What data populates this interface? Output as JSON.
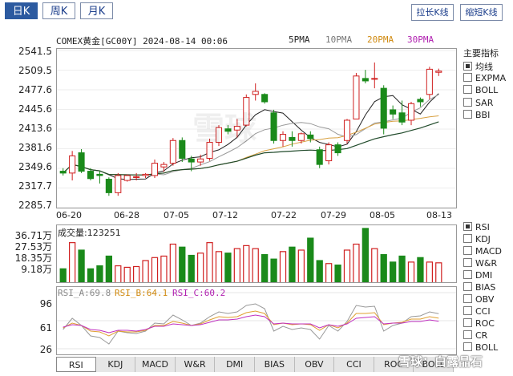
{
  "period_tabs": [
    "日K",
    "周K",
    "月K"
  ],
  "right_buttons": [
    "拉长K线",
    "缩短K线"
  ],
  "chart": {
    "title": "COMEX黄金[GC00Y] 2024-08-14 00:06",
    "ma_legend": [
      {
        "label": "5PMA",
        "color": "#222222"
      },
      {
        "label": "10PMA",
        "color": "#999999"
      },
      {
        "label": "20PMA",
        "color": "#e0a030"
      },
      {
        "label": "30PMA",
        "color": "#c030c0"
      }
    ],
    "y_ticks": [
      "2541.5",
      "2509.5",
      "2477.6",
      "2445.6",
      "2413.6",
      "2381.6",
      "2349.6",
      "2317.7",
      "2285.7"
    ],
    "x_ticks": [
      "06-20",
      "06-28",
      "07-05",
      "07-12",
      "07-22",
      "07-29",
      "08-05",
      "08-13"
    ],
    "watermark": "雪球"
  },
  "indicators": {
    "title": "主要指标",
    "main": [
      {
        "label": "均线",
        "checked": true
      },
      {
        "label": "EXPMA",
        "checked": false
      },
      {
        "label": "BOLL",
        "checked": false
      },
      {
        "label": "SAR",
        "checked": false
      },
      {
        "label": "BBI",
        "checked": false
      }
    ],
    "sub": [
      {
        "label": "RSI",
        "checked": true
      },
      {
        "label": "KDJ",
        "checked": false
      },
      {
        "label": "MACD",
        "checked": false
      },
      {
        "label": "W&R",
        "checked": false
      },
      {
        "label": "DMI",
        "checked": false
      },
      {
        "label": "BIAS",
        "checked": false
      },
      {
        "label": "OBV",
        "checked": false
      },
      {
        "label": "CCI",
        "checked": false
      },
      {
        "label": "ROC",
        "checked": false
      },
      {
        "label": "CR",
        "checked": false
      },
      {
        "label": "BOLL",
        "checked": false
      }
    ]
  },
  "volume": {
    "label": "成交量:123251",
    "y_ticks": [
      "36.71万",
      "27.53万",
      "18.35万",
      "9.18万"
    ]
  },
  "rsi": {
    "labels": [
      {
        "text": "RSI_A:69.8",
        "color": "#888888"
      },
      {
        "text": "RSI_B:64.1",
        "color": "#e0a030"
      },
      {
        "text": "RSI_C:60.2",
        "color": "#c030c0"
      }
    ],
    "y_ticks": [
      "96",
      "61",
      "26"
    ]
  },
  "bottom_tabs": [
    "RSI",
    "KDJ",
    "MACD",
    "W&R",
    "DMI",
    "BIAS",
    "OBV",
    "CCI",
    "ROC",
    "BOLL"
  ],
  "footer_brand": "雪球：白露晶石",
  "colors": {
    "up": "#d02020",
    "down": "#1a8a1a",
    "accent": "#2c5aa0"
  },
  "chart_data": {
    "type": "candlestick",
    "ylim": [
      2285.7,
      2541.5
    ],
    "x_ticks": [
      "06-20",
      "06-28",
      "07-05",
      "07-12",
      "07-22",
      "07-29",
      "08-05",
      "08-13"
    ],
    "ohlc": [
      [
        2345,
        2350,
        2338,
        2342
      ],
      [
        2342,
        2378,
        2330,
        2370
      ],
      [
        2375,
        2381,
        2342,
        2345
      ],
      [
        2345,
        2350,
        2330,
        2333
      ],
      [
        2340,
        2345,
        2325,
        2338
      ],
      [
        2332,
        2335,
        2305,
        2310
      ],
      [
        2310,
        2342,
        2305,
        2338
      ],
      [
        2330,
        2340,
        2328,
        2338
      ],
      [
        2335,
        2342,
        2330,
        2336
      ],
      [
        2338,
        2342,
        2334,
        2340
      ],
      [
        2338,
        2364,
        2334,
        2358
      ],
      [
        2352,
        2360,
        2344,
        2356
      ],
      [
        2358,
        2399,
        2354,
        2395
      ],
      [
        2395,
        2400,
        2360,
        2366
      ],
      [
        2365,
        2370,
        2345,
        2360
      ],
      [
        2360,
        2372,
        2354,
        2365
      ],
      [
        2366,
        2398,
        2362,
        2392
      ],
      [
        2392,
        2420,
        2386,
        2416
      ],
      [
        2414,
        2420,
        2405,
        2410
      ],
      [
        2412,
        2430,
        2400,
        2418
      ],
      [
        2420,
        2470,
        2418,
        2465
      ],
      [
        2470,
        2488,
        2460,
        2475
      ],
      [
        2470,
        2472,
        2455,
        2458
      ],
      [
        2440,
        2445,
        2390,
        2395
      ],
      [
        2395,
        2410,
        2385,
        2405
      ],
      [
        2400,
        2410,
        2385,
        2395
      ],
      [
        2395,
        2408,
        2390,
        2406
      ],
      [
        2404,
        2410,
        2392,
        2398
      ],
      [
        2380,
        2385,
        2350,
        2356
      ],
      [
        2362,
        2392,
        2356,
        2388
      ],
      [
        2388,
        2392,
        2370,
        2375
      ],
      [
        2395,
        2430,
        2390,
        2428
      ],
      [
        2430,
        2505,
        2430,
        2500
      ],
      [
        2496,
        2510,
        2488,
        2492
      ],
      [
        2495,
        2522,
        2480,
        2496
      ],
      [
        2480,
        2485,
        2405,
        2415
      ],
      [
        2445,
        2452,
        2430,
        2438
      ],
      [
        2440,
        2460,
        2420,
        2425
      ],
      [
        2428,
        2458,
        2420,
        2455
      ],
      [
        2462,
        2465,
        2450,
        2458
      ],
      [
        2470,
        2515,
        2462,
        2511
      ],
      [
        2506,
        2512,
        2500,
        2508
      ]
    ],
    "volume": [
      9.5,
      27.0,
      22.0,
      9.5,
      11.5,
      18.0,
      11.5,
      10.5,
      11.0,
      15.0,
      17.0,
      18.0,
      26.0,
      24.0,
      18.5,
      20.0,
      27.0,
      21.0,
      20.0,
      23.0,
      25.0,
      23.0,
      19.0,
      16.0,
      21.0,
      24.0,
      22.0,
      30.0,
      15.0,
      13.0,
      12.0,
      22.0,
      26.0,
      36.5,
      23.0,
      19.0,
      14.0,
      18.0,
      14.0,
      17.0,
      14.0,
      13.5
    ],
    "volume_unit": "万",
    "rsi_ylim": [
      20,
      100
    ],
    "rsi_a": [
      50,
      64,
      55,
      42,
      40,
      32,
      48,
      46,
      45,
      48,
      58,
      57,
      68,
      62,
      55,
      58,
      66,
      72,
      70,
      72,
      80,
      82,
      76,
      48,
      54,
      50,
      52,
      50,
      38,
      55,
      48,
      60,
      80,
      78,
      79,
      48,
      55,
      58,
      66,
      67,
      72,
      69.8
    ],
    "rsi_b": [
      52,
      58,
      55,
      48,
      47,
      42,
      48,
      47,
      47,
      49,
      55,
      55,
      60,
      58,
      55,
      57,
      62,
      66,
      65,
      66,
      71,
      73,
      70,
      56,
      58,
      56,
      57,
      56,
      49,
      56,
      52,
      58,
      70,
      70,
      71,
      56,
      58,
      59,
      63,
      63,
      66,
      64.1
    ],
    "rsi_c": [
      53,
      56,
      55,
      50,
      49,
      46,
      49,
      49,
      48,
      50,
      54,
      54,
      57,
      56,
      55,
      56,
      59,
      62,
      62,
      63,
      66,
      68,
      66,
      57,
      58,
      57,
      57,
      57,
      52,
      56,
      54,
      57,
      64,
      65,
      66,
      57,
      58,
      58,
      60,
      60,
      62,
      60.2
    ]
  }
}
